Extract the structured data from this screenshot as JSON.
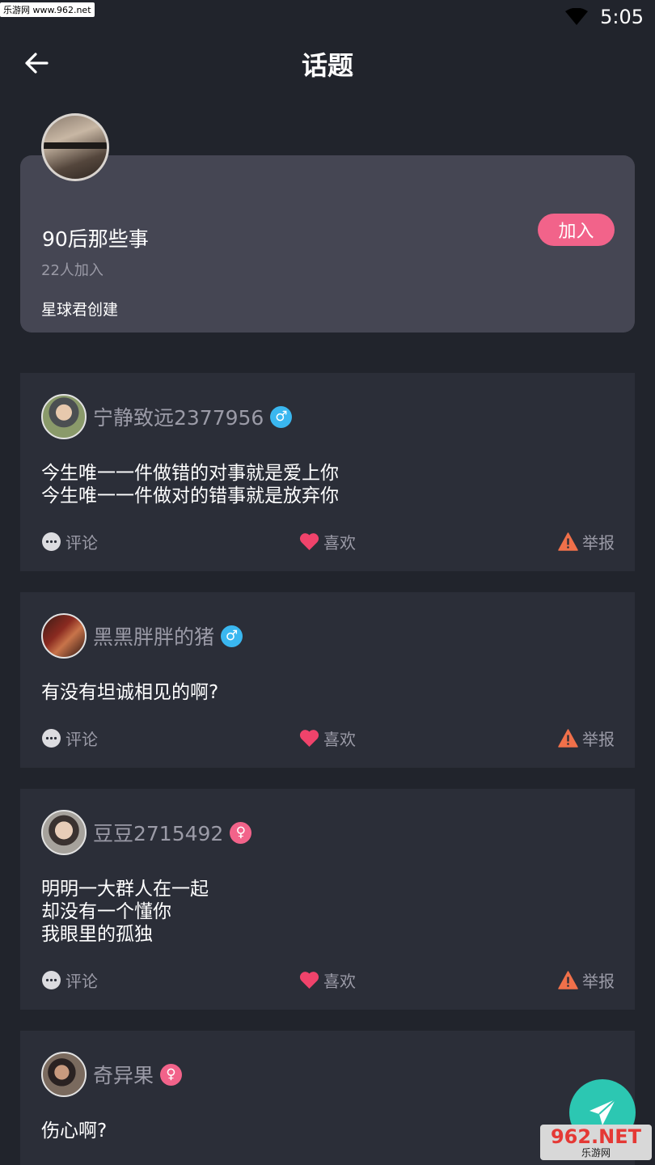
{
  "watermark_top": "乐游网 www.962.net",
  "status": {
    "time": "5:05",
    "wifi_icon": "wifi-icon"
  },
  "header": {
    "title": "话题",
    "back_icon": "arrow-left-icon"
  },
  "topic": {
    "name": "90后那些事",
    "count": "22人加入",
    "creator": "星球君创建",
    "join_label": "加入"
  },
  "actions": {
    "comment": "评论",
    "like": "喜欢",
    "report": "举报"
  },
  "posts": [
    {
      "username": "宁静致远2377956",
      "gender": "male",
      "gender_symbol": "♂",
      "lines": [
        "今生唯一一件做错的对事就是爱上你",
        "今生唯一一件做对的错事就是放弃你"
      ]
    },
    {
      "username": "黑黑胖胖的猪",
      "gender": "male",
      "gender_symbol": "♂",
      "lines": [
        "有没有坦诚相见的啊?"
      ]
    },
    {
      "username": "豆豆2715492",
      "gender": "female",
      "gender_symbol": "♀",
      "lines": [
        "明明一大群人在一起",
        "却没有一个懂你",
        "我眼里的孤独"
      ]
    },
    {
      "username": "奇异果",
      "gender": "female",
      "gender_symbol": "♀",
      "lines": [
        "伤心啊?"
      ]
    }
  ],
  "fab_icon": "paper-plane-icon",
  "watermark_bottom": {
    "main": "962.NET",
    "sub": "乐游网"
  },
  "colors": {
    "accent_pink": "#f2638a",
    "male_blue": "#3ab7f0",
    "fab_teal": "#2cc7b2",
    "background": "#21242c"
  }
}
